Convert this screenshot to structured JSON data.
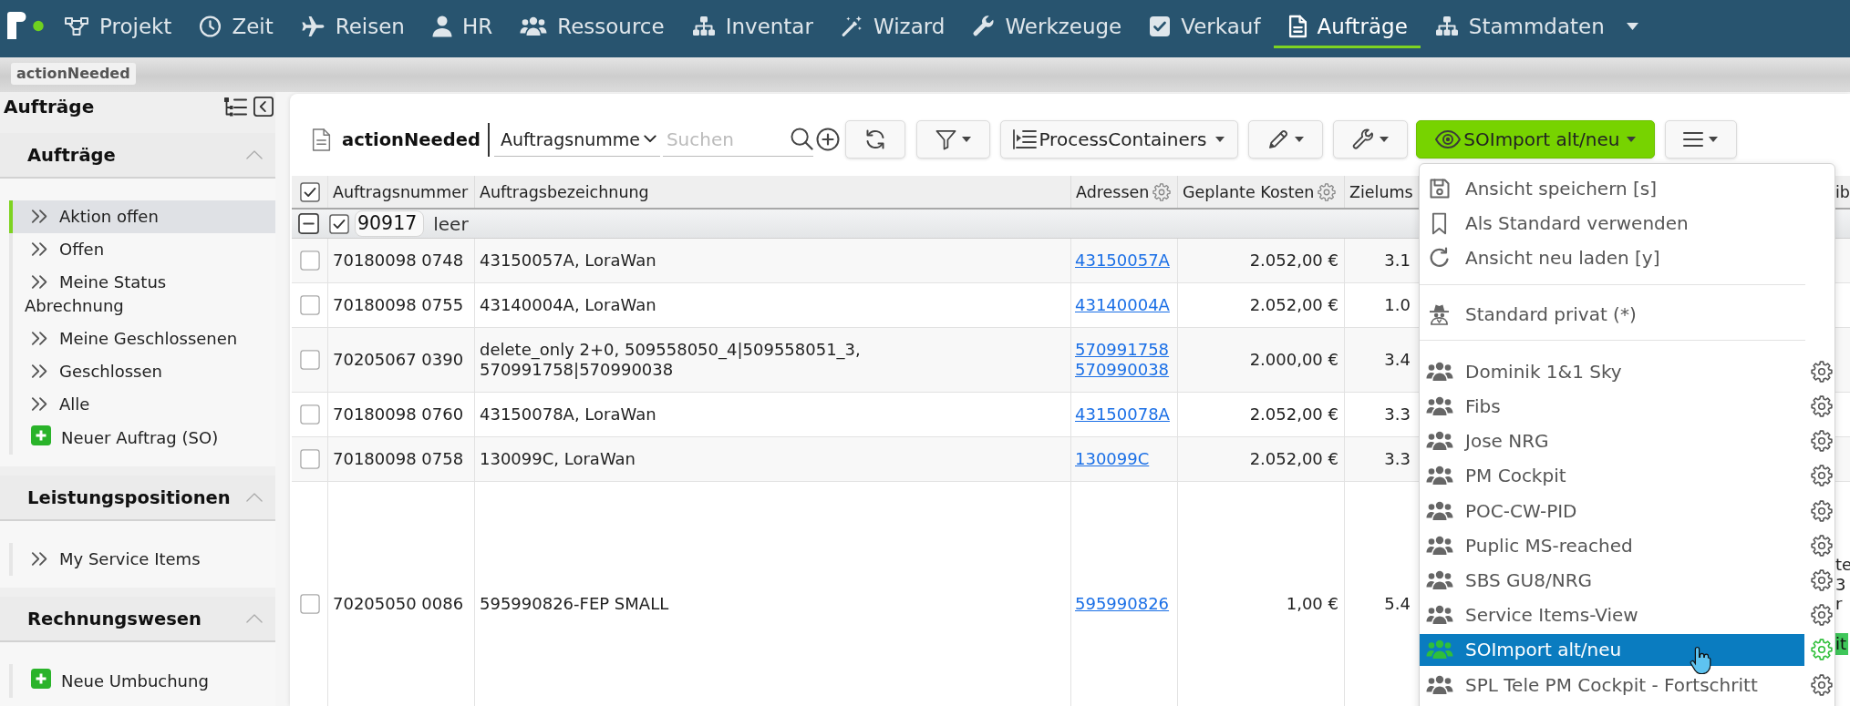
{
  "nav": {
    "items": [
      {
        "label": "Projekt",
        "selected": false
      },
      {
        "label": "Zeit",
        "selected": false
      },
      {
        "label": "Reisen",
        "selected": false
      },
      {
        "label": "HR",
        "selected": false
      },
      {
        "label": "Ressource",
        "selected": false
      },
      {
        "label": "Inventar",
        "selected": false
      },
      {
        "label": "Wizard",
        "selected": false
      },
      {
        "label": "Werkzeuge",
        "selected": false
      },
      {
        "label": "Verkauf",
        "selected": false
      },
      {
        "label": "Aufträge",
        "selected": true
      },
      {
        "label": "Stammdaten",
        "selected": false
      }
    ]
  },
  "breadcrumb": {
    "chip": "actionNeeded"
  },
  "sidebar": {
    "title": "Aufträge",
    "sections": [
      {
        "title": "Aufträge",
        "expanded": true,
        "items": [
          {
            "label": "Aktion offen",
            "kind": "link",
            "selected": true
          },
          {
            "label": "Offen",
            "kind": "link",
            "selected": false
          },
          {
            "label": "Meine Status Abrechnung",
            "kind": "link",
            "selected": false
          },
          {
            "label": "Meine Geschlossenen",
            "kind": "link",
            "selected": false
          },
          {
            "label": "Geschlossen",
            "kind": "link",
            "selected": false
          },
          {
            "label": "Alle",
            "kind": "link",
            "selected": false
          },
          {
            "label": "Neuer Auftrag (SO)",
            "kind": "create",
            "selected": false
          }
        ]
      },
      {
        "title": "Leistungspositionen",
        "expanded": true,
        "items": [
          {
            "label": "My Service Items",
            "kind": "link",
            "selected": false
          }
        ]
      },
      {
        "title": "Rechnungswesen",
        "expanded": true,
        "items": [
          {
            "label": "Neue Umbuchung",
            "kind": "create",
            "selected": false
          }
        ]
      }
    ]
  },
  "toolbar": {
    "view_name": "actionNeeded",
    "search_column": "Auftragsnumme",
    "search": {
      "placeholder": "Suchen"
    },
    "process_button": "ProcessContainers",
    "view_button": "SOImport alt/neu"
  },
  "table": {
    "select_all": true,
    "columns": [
      {
        "label": "Auftragsnummer",
        "settings": false
      },
      {
        "label": "Auftragsbezeichnung",
        "settings": false
      },
      {
        "label": "Adressen",
        "settings": true
      },
      {
        "label": "Geplante Kosten",
        "settings": true
      },
      {
        "label": "Zielums",
        "settings": false
      },
      {
        "label": "ib",
        "settings": false
      }
    ],
    "group": {
      "expanded": true,
      "checked": true,
      "value": "90917",
      "label": "leer"
    },
    "rows": [
      {
        "checked": false,
        "order_number": "70180098 0748",
        "description": "43150057A, LoraWan",
        "addresses": [
          "43150057A"
        ],
        "planned_costs": "2.052,00 €",
        "column_5": "3.1"
      },
      {
        "checked": false,
        "order_number": "70180098 0755",
        "description": "43140004A, LoraWan",
        "addresses": [
          "43140004A"
        ],
        "planned_costs": "2.052,00 €",
        "column_5": "1.0"
      },
      {
        "checked": false,
        "order_number": "70205067 0390",
        "description": "delete_only 2+0, 509558050_4|509558051_3,\n570991758|570990038",
        "addresses": [
          "570991758",
          "570990038"
        ],
        "planned_costs": "2.000,00 €",
        "column_5": "3.4"
      },
      {
        "checked": false,
        "order_number": "70180098 0760",
        "description": "43150078A, LoraWan",
        "addresses": [
          "43150078A"
        ],
        "planned_costs": "2.052,00 €",
        "column_5": "3.3"
      },
      {
        "checked": false,
        "order_number": "70180098 0758",
        "description": "130099C, LoraWan",
        "addresses": [
          "130099C"
        ],
        "planned_costs": "2.052,00 €",
        "column_5": "3.3"
      },
      {
        "checked": false,
        "order_number": "70205050 0086",
        "description": "595990826-FEP SMALL",
        "addresses": [
          "595990826"
        ],
        "planned_costs": "1,00 €",
        "column_5": "5.4",
        "column_6": {
          "lines": [
            "te",
            "3",
            "r"
          ],
          "tag": "it"
        }
      }
    ]
  },
  "view_menu": {
    "open": true,
    "actions": [
      {
        "label": "Ansicht speichern [s]"
      },
      {
        "label": "Als Standard verwenden"
      },
      {
        "label": "Ansicht neu laden [y]"
      }
    ],
    "private_views": [
      {
        "label": "Standard privat (*)",
        "selected": false
      }
    ],
    "shared_views": [
      {
        "label": "Dominik 1&1 Sky",
        "selected": false
      },
      {
        "label": "Fibs",
        "selected": false
      },
      {
        "label": "Jose NRG",
        "selected": false
      },
      {
        "label": "PM Cockpit",
        "selected": false
      },
      {
        "label": "POC-CW-PID",
        "selected": false
      },
      {
        "label": "Puplic MS-reached",
        "selected": false
      },
      {
        "label": "SBS GU8/NRG",
        "selected": false
      },
      {
        "label": "Service Items-View",
        "selected": false
      },
      {
        "label": "SOImport alt/neu",
        "selected": true
      },
      {
        "label": "SPL Tele PM Cockpit - Fortschritt",
        "selected": false
      }
    ]
  }
}
